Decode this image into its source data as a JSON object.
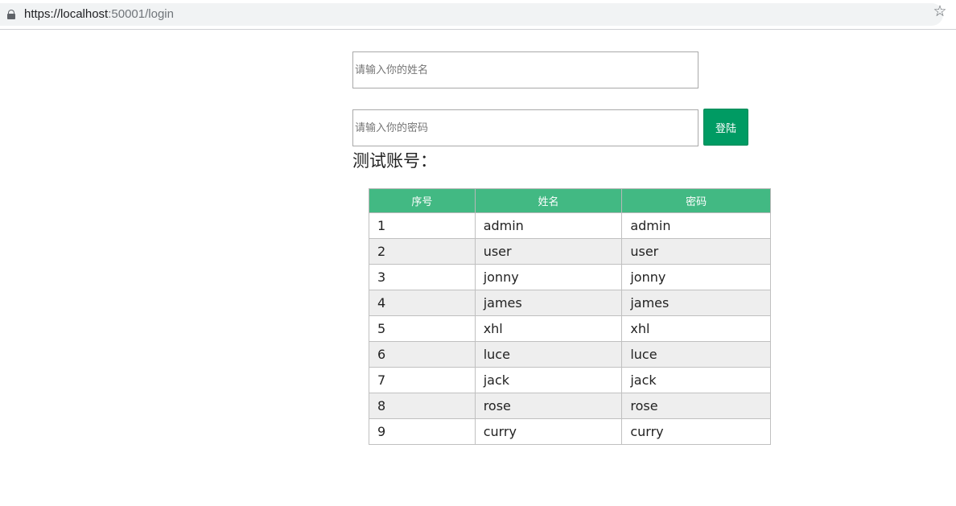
{
  "browser": {
    "url_host": "https://localhost",
    "url_rest": ":50001/login"
  },
  "form": {
    "name_placeholder": "请输入你的姓名",
    "password_placeholder": "请输入你的密码",
    "login_label": "登陆"
  },
  "section_title": "测试账号：",
  "table": {
    "headers": [
      "序号",
      "姓名",
      "密码"
    ],
    "rows": [
      [
        "1",
        "admin",
        "admin"
      ],
      [
        "2",
        "user",
        "user"
      ],
      [
        "3",
        "jonny",
        "jonny"
      ],
      [
        "4",
        "james",
        "james"
      ],
      [
        "5",
        "xhl",
        "xhl"
      ],
      [
        "6",
        "luce",
        "luce"
      ],
      [
        "7",
        "jack",
        "jack"
      ],
      [
        "8",
        "rose",
        "rose"
      ],
      [
        "9",
        "curry",
        "curry"
      ]
    ]
  },
  "colors": {
    "header_bg": "#42b983",
    "button_bg": "#009b63",
    "stripe_bg": "#eeeeee"
  },
  "icons": {
    "lock": "lock-icon",
    "bookmark": "star-icon"
  }
}
